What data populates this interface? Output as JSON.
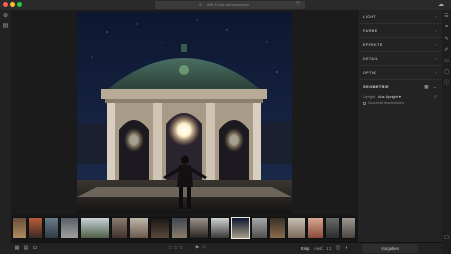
{
  "app": {
    "search_placeholder": "Alle Fotos durchsuchen"
  },
  "panel": {
    "sections": [
      "LICHT",
      "FARBE",
      "EFFEKTE",
      "DETAIL",
      "OPTIK",
      "GEOMETRIE"
    ],
    "geometry": {
      "upright_label": "Upright",
      "upright_value": "Aus Upright",
      "constrain_label": "Zuschnitt beschränken"
    }
  },
  "bottom": {
    "fit_label": "Einp.",
    "full_label": "Ausf.",
    "ratio_label": "1:1",
    "original_button": "Vorgaben"
  },
  "colors": {
    "accent": "#2d8cf0",
    "panel": "#232323"
  }
}
